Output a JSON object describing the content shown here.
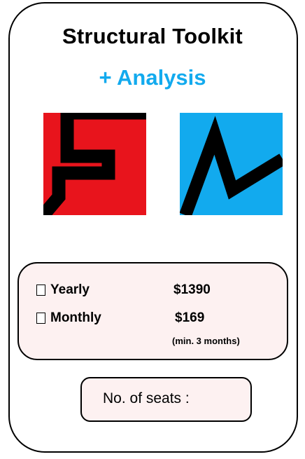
{
  "product": {
    "title": "Structural Toolkit",
    "subtitle": "+ Analysis",
    "accent_color": "#12aaee"
  },
  "logos": [
    {
      "name": "red-s-logo",
      "background": "#e8141c",
      "stroke": "#000000"
    },
    {
      "name": "blue-n-logo",
      "background": "#12aaee",
      "stroke": "#000000"
    }
  ],
  "pricing": {
    "options": [
      {
        "label": "Yearly",
        "price": "$1390",
        "checked": false
      },
      {
        "label": "Monthly",
        "price": "$169",
        "checked": false
      }
    ],
    "monthly_note": "(min. 3 months)",
    "panel_color": "#fdf1f1"
  },
  "seats": {
    "label": "No. of seats :",
    "value": ""
  }
}
